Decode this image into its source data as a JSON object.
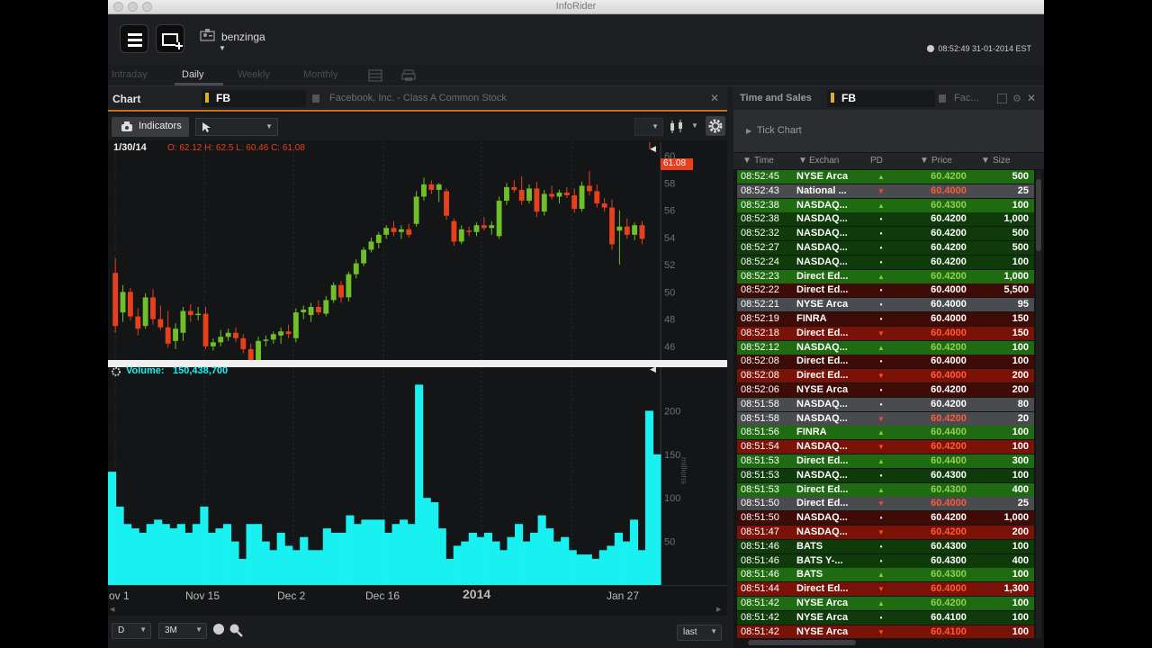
{
  "window": {
    "title": "InfoRider"
  },
  "topbar": {
    "user": "benzinga",
    "clock": "08:52:49 31-01-2014 EST"
  },
  "periods": [
    "Intraday",
    "Daily",
    "Weekly",
    "Monthly"
  ],
  "active_period": "Daily",
  "chart_panel": {
    "title": "Chart",
    "symbol": "FB",
    "description": "Facebook, Inc. - Class A Common Stock",
    "indicators_label": "Indicators",
    "ohlc_date": "1/30/14",
    "ohlc_text": "O: 62.12  H: 62.5  L: 60.46  C: 61.08",
    "last_price_tag": "61.08",
    "volume_label": "Volume:",
    "volume_value": "150,438,700",
    "volume_unit": "millions",
    "price_ticks": [
      "60",
      "58",
      "56",
      "54",
      "52",
      "50",
      "48",
      "46"
    ],
    "volume_ticks": [
      "200",
      "150",
      "100",
      "50"
    ],
    "x_ticks": [
      "ov 1",
      "Nov 15",
      "Dec 2",
      "Dec 16",
      "2014",
      "Jan 27"
    ],
    "bottom": {
      "interval": "D",
      "range": "3M",
      "price_type": "last"
    }
  },
  "chart_data": {
    "type": "candlestick",
    "title": "",
    "price_range": [
      45,
      61
    ],
    "volume_range": [
      0,
      250
    ],
    "candles": [
      {
        "o": 51.4,
        "h": 52.5,
        "l": 47.0,
        "c": 47.5
      },
      {
        "o": 48.5,
        "h": 50.5,
        "l": 47.8,
        "c": 50.0
      },
      {
        "o": 50.0,
        "h": 50.3,
        "l": 47.9,
        "c": 48.2
      },
      {
        "o": 48.2,
        "h": 48.8,
        "l": 46.8,
        "c": 47.3
      },
      {
        "o": 47.5,
        "h": 49.9,
        "l": 47.3,
        "c": 49.6
      },
      {
        "o": 49.6,
        "h": 50.2,
        "l": 47.6,
        "c": 48.0
      },
      {
        "o": 48.0,
        "h": 49.0,
        "l": 47.2,
        "c": 47.4
      },
      {
        "o": 47.4,
        "h": 48.6,
        "l": 45.9,
        "c": 46.2
      },
      {
        "o": 46.4,
        "h": 47.7,
        "l": 45.8,
        "c": 47.3
      },
      {
        "o": 47.0,
        "h": 48.9,
        "l": 46.4,
        "c": 48.6
      },
      {
        "o": 48.6,
        "h": 49.1,
        "l": 47.8,
        "c": 48.3
      },
      {
        "o": 48.3,
        "h": 48.9,
        "l": 47.9,
        "c": 48.4
      },
      {
        "o": 48.4,
        "h": 48.9,
        "l": 45.8,
        "c": 46.0
      },
      {
        "o": 46.0,
        "h": 46.6,
        "l": 45.7,
        "c": 46.3
      },
      {
        "o": 46.3,
        "h": 47.2,
        "l": 46.0,
        "c": 46.7
      },
      {
        "o": 46.7,
        "h": 47.3,
        "l": 46.4,
        "c": 47.0
      },
      {
        "o": 47.0,
        "h": 47.4,
        "l": 46.3,
        "c": 46.6
      },
      {
        "o": 46.6,
        "h": 46.9,
        "l": 45.5,
        "c": 45.8
      },
      {
        "o": 45.8,
        "h": 46.2,
        "l": 44.5,
        "c": 44.9
      },
      {
        "o": 45.0,
        "h": 46.7,
        "l": 44.7,
        "c": 46.4
      },
      {
        "o": 46.4,
        "h": 46.8,
        "l": 46.0,
        "c": 46.5
      },
      {
        "o": 46.5,
        "h": 47.1,
        "l": 46.2,
        "c": 46.9
      },
      {
        "o": 46.8,
        "h": 47.4,
        "l": 46.2,
        "c": 47.1
      },
      {
        "o": 47.1,
        "h": 47.6,
        "l": 46.6,
        "c": 46.9
      },
      {
        "o": 46.6,
        "h": 48.8,
        "l": 46.3,
        "c": 48.5
      },
      {
        "o": 48.5,
        "h": 49.0,
        "l": 48.0,
        "c": 48.7
      },
      {
        "o": 48.3,
        "h": 49.2,
        "l": 47.8,
        "c": 48.9
      },
      {
        "o": 48.9,
        "h": 49.4,
        "l": 48.3,
        "c": 48.5
      },
      {
        "o": 48.4,
        "h": 49.7,
        "l": 48.2,
        "c": 49.4
      },
      {
        "o": 49.4,
        "h": 50.7,
        "l": 49.2,
        "c": 50.5
      },
      {
        "o": 50.5,
        "h": 50.8,
        "l": 49.2,
        "c": 49.6
      },
      {
        "o": 49.6,
        "h": 51.5,
        "l": 49.3,
        "c": 51.3
      },
      {
        "o": 51.3,
        "h": 52.4,
        "l": 51.0,
        "c": 52.1
      },
      {
        "o": 52.1,
        "h": 53.3,
        "l": 51.9,
        "c": 53.1
      },
      {
        "o": 53.1,
        "h": 54.0,
        "l": 52.9,
        "c": 53.7
      },
      {
        "o": 53.6,
        "h": 54.4,
        "l": 53.2,
        "c": 54.2
      },
      {
        "o": 54.2,
        "h": 54.9,
        "l": 53.9,
        "c": 54.7
      },
      {
        "o": 54.7,
        "h": 55.2,
        "l": 54.1,
        "c": 54.4
      },
      {
        "o": 54.4,
        "h": 54.9,
        "l": 53.9,
        "c": 54.6
      },
      {
        "o": 54.6,
        "h": 55.0,
        "l": 54.0,
        "c": 54.2
      },
      {
        "o": 55.0,
        "h": 57.4,
        "l": 54.8,
        "c": 57.0
      },
      {
        "o": 57.0,
        "h": 58.4,
        "l": 56.7,
        "c": 57.9
      },
      {
        "o": 57.9,
        "h": 58.2,
        "l": 57.2,
        "c": 57.5
      },
      {
        "o": 57.5,
        "h": 58.0,
        "l": 56.6,
        "c": 57.9
      },
      {
        "o": 57.4,
        "h": 57.6,
        "l": 55.3,
        "c": 55.6
      },
      {
        "o": 55.2,
        "h": 55.4,
        "l": 53.4,
        "c": 53.7
      },
      {
        "o": 53.7,
        "h": 54.9,
        "l": 53.5,
        "c": 54.6
      },
      {
        "o": 54.5,
        "h": 54.8,
        "l": 54.1,
        "c": 54.4
      },
      {
        "o": 54.4,
        "h": 55.1,
        "l": 54.1,
        "c": 54.9
      },
      {
        "o": 54.9,
        "h": 55.5,
        "l": 54.5,
        "c": 54.7
      },
      {
        "o": 54.7,
        "h": 55.2,
        "l": 54.2,
        "c": 54.9
      },
      {
        "o": 54.1,
        "h": 57.0,
        "l": 53.9,
        "c": 56.7
      },
      {
        "o": 56.7,
        "h": 58.0,
        "l": 56.4,
        "c": 57.7
      },
      {
        "o": 57.7,
        "h": 58.2,
        "l": 57.3,
        "c": 57.5
      },
      {
        "o": 57.5,
        "h": 58.5,
        "l": 56.4,
        "c": 56.7
      },
      {
        "o": 56.7,
        "h": 57.9,
        "l": 56.5,
        "c": 57.6
      },
      {
        "o": 57.6,
        "h": 58.1,
        "l": 55.5,
        "c": 55.9
      },
      {
        "o": 55.9,
        "h": 57.5,
        "l": 55.6,
        "c": 57.2
      },
      {
        "o": 57.2,
        "h": 57.8,
        "l": 56.8,
        "c": 57.0
      },
      {
        "o": 57.0,
        "h": 57.5,
        "l": 56.5,
        "c": 57.3
      },
      {
        "o": 57.3,
        "h": 57.7,
        "l": 56.9,
        "c": 57.1
      },
      {
        "o": 57.1,
        "h": 57.6,
        "l": 55.8,
        "c": 56.1
      },
      {
        "o": 56.1,
        "h": 58.1,
        "l": 55.9,
        "c": 57.8
      },
      {
        "o": 57.8,
        "h": 58.9,
        "l": 57.1,
        "c": 57.4
      },
      {
        "o": 57.4,
        "h": 57.9,
        "l": 56.2,
        "c": 56.5
      },
      {
        "o": 56.5,
        "h": 56.9,
        "l": 55.9,
        "c": 56.2
      },
      {
        "o": 56.2,
        "h": 56.8,
        "l": 53.1,
        "c": 53.5
      },
      {
        "o": 54.5,
        "h": 56.0,
        "l": 52.0,
        "c": 54.8
      },
      {
        "o": 54.8,
        "h": 55.4,
        "l": 53.9,
        "c": 54.2
      },
      {
        "o": 54.2,
        "h": 55.1,
        "l": 53.8,
        "c": 54.9
      },
      {
        "o": 54.9,
        "h": 55.2,
        "l": 53.5,
        "c": 53.9
      },
      {
        "o": 62.1,
        "h": 62.5,
        "l": 60.5,
        "c": 61.1
      }
    ],
    "volume": [
      130,
      90,
      70,
      65,
      60,
      70,
      75,
      70,
      65,
      70,
      60,
      70,
      90,
      60,
      65,
      70,
      50,
      30,
      70,
      70,
      50,
      40,
      60,
      45,
      40,
      55,
      40,
      40,
      65,
      60,
      60,
      80,
      70,
      75,
      75,
      75,
      60,
      70,
      75,
      70,
      230,
      100,
      95,
      65,
      30,
      45,
      50,
      60,
      55,
      60,
      50,
      40,
      55,
      70,
      50,
      60,
      80,
      65,
      50,
      55,
      40,
      35,
      35,
      30,
      40,
      45,
      60,
      50,
      75,
      40,
      200,
      150
    ]
  },
  "time_and_sales": {
    "title": "Time and Sales",
    "symbol": "FB",
    "description_short": "Fac...",
    "tick_chart_label": "Tick Chart",
    "columns": [
      "Time",
      "Exchan",
      "PD",
      "Price",
      "Size"
    ],
    "rows": [
      {
        "time": "08:52:45",
        "exch": "NYSE Arca",
        "pd": "up",
        "price": "60.4200",
        "size": "500",
        "tone": "green"
      },
      {
        "time": "08:52:43",
        "exch": "National ...",
        "pd": "down",
        "price": "60.4000",
        "size": "25",
        "tone": "gray"
      },
      {
        "time": "08:52:38",
        "exch": "NASDAQ...",
        "pd": "up",
        "price": "60.4300",
        "size": "100",
        "tone": "green"
      },
      {
        "time": "08:52:38",
        "exch": "NASDAQ...",
        "pd": "flat",
        "price": "60.4200",
        "size": "1,000",
        "tone": "darkgreen"
      },
      {
        "time": "08:52:32",
        "exch": "NASDAQ...",
        "pd": "flat",
        "price": "60.4200",
        "size": "500",
        "tone": "darkgreen"
      },
      {
        "time": "08:52:27",
        "exch": "NASDAQ...",
        "pd": "flat",
        "price": "60.4200",
        "size": "500",
        "tone": "darkgreen"
      },
      {
        "time": "08:52:24",
        "exch": "NASDAQ...",
        "pd": "flat",
        "price": "60.4200",
        "size": "100",
        "tone": "darkgreen"
      },
      {
        "time": "08:52:23",
        "exch": "Direct Ed...",
        "pd": "up",
        "price": "60.4200",
        "size": "1,000",
        "tone": "green"
      },
      {
        "time": "08:52:22",
        "exch": "Direct Ed...",
        "pd": "flat",
        "price": "60.4000",
        "size": "5,500",
        "tone": "darkred"
      },
      {
        "time": "08:52:21",
        "exch": "NYSE Arca",
        "pd": "flat",
        "price": "60.4000",
        "size": "95",
        "tone": "gray"
      },
      {
        "time": "08:52:19",
        "exch": "FINRA",
        "pd": "flat",
        "price": "60.4000",
        "size": "150",
        "tone": "darkred"
      },
      {
        "time": "08:52:18",
        "exch": "Direct Ed...",
        "pd": "down",
        "price": "60.4000",
        "size": "150",
        "tone": "red"
      },
      {
        "time": "08:52:12",
        "exch": "NASDAQ...",
        "pd": "up",
        "price": "60.4200",
        "size": "100",
        "tone": "green"
      },
      {
        "time": "08:52:08",
        "exch": "Direct Ed...",
        "pd": "flat",
        "price": "60.4000",
        "size": "100",
        "tone": "darkred"
      },
      {
        "time": "08:52:08",
        "exch": "Direct Ed...",
        "pd": "down",
        "price": "60.4000",
        "size": "200",
        "tone": "red"
      },
      {
        "time": "08:52:06",
        "exch": "NYSE Arca",
        "pd": "flat",
        "price": "60.4200",
        "size": "200",
        "tone": "darkred"
      },
      {
        "time": "08:51:58",
        "exch": "NASDAQ...",
        "pd": "flat",
        "price": "60.4200",
        "size": "80",
        "tone": "gray"
      },
      {
        "time": "08:51:58",
        "exch": "NASDAQ...",
        "pd": "down",
        "price": "60.4200",
        "size": "20",
        "tone": "gray"
      },
      {
        "time": "08:51:56",
        "exch": "FINRA",
        "pd": "up",
        "price": "60.4400",
        "size": "100",
        "tone": "green"
      },
      {
        "time": "08:51:54",
        "exch": "NASDAQ...",
        "pd": "down",
        "price": "60.4200",
        "size": "100",
        "tone": "red"
      },
      {
        "time": "08:51:53",
        "exch": "Direct Ed...",
        "pd": "up",
        "price": "60.4400",
        "size": "300",
        "tone": "green"
      },
      {
        "time": "08:51:53",
        "exch": "NASDAQ...",
        "pd": "flat",
        "price": "60.4300",
        "size": "100",
        "tone": "darkgreen"
      },
      {
        "time": "08:51:53",
        "exch": "Direct Ed...",
        "pd": "up",
        "price": "60.4300",
        "size": "400",
        "tone": "green"
      },
      {
        "time": "08:51:50",
        "exch": "Direct Ed...",
        "pd": "down",
        "price": "60.4000",
        "size": "25",
        "tone": "gray"
      },
      {
        "time": "08:51:50",
        "exch": "NASDAQ...",
        "pd": "flat",
        "price": "60.4200",
        "size": "1,000",
        "tone": "darkred"
      },
      {
        "time": "08:51:47",
        "exch": "NASDAQ...",
        "pd": "down",
        "price": "60.4200",
        "size": "200",
        "tone": "red"
      },
      {
        "time": "08:51:46",
        "exch": "BATS",
        "pd": "flat",
        "price": "60.4300",
        "size": "100",
        "tone": "darkgreen"
      },
      {
        "time": "08:51:46",
        "exch": "BATS Y-...",
        "pd": "flat",
        "price": "60.4300",
        "size": "400",
        "tone": "darkgreen"
      },
      {
        "time": "08:51:46",
        "exch": "BATS",
        "pd": "up",
        "price": "60.4300",
        "size": "100",
        "tone": "green"
      },
      {
        "time": "08:51:44",
        "exch": "Direct Ed...",
        "pd": "down",
        "price": "60.4000",
        "size": "1,300",
        "tone": "red"
      },
      {
        "time": "08:51:42",
        "exch": "NYSE Arca",
        "pd": "up",
        "price": "60.4200",
        "size": "100",
        "tone": "green"
      },
      {
        "time": "08:51:42",
        "exch": "NYSE Arca",
        "pd": "flat",
        "price": "60.4100",
        "size": "100",
        "tone": "darkgreen"
      },
      {
        "time": "08:51:42",
        "exch": "NYSE Arca",
        "pd": "down",
        "price": "60.4100",
        "size": "100",
        "tone": "red"
      }
    ]
  },
  "colors": {
    "up": "#6fbf2b",
    "down": "#e8401c",
    "volume": "#19f0f0",
    "accent": "#c2701f",
    "row_green": "#1f6b12",
    "row_darkgreen": "#0f3a0a",
    "row_red": "#7a1208",
    "row_darkred": "#3e0b06",
    "row_gray": "#4a4b4e"
  }
}
